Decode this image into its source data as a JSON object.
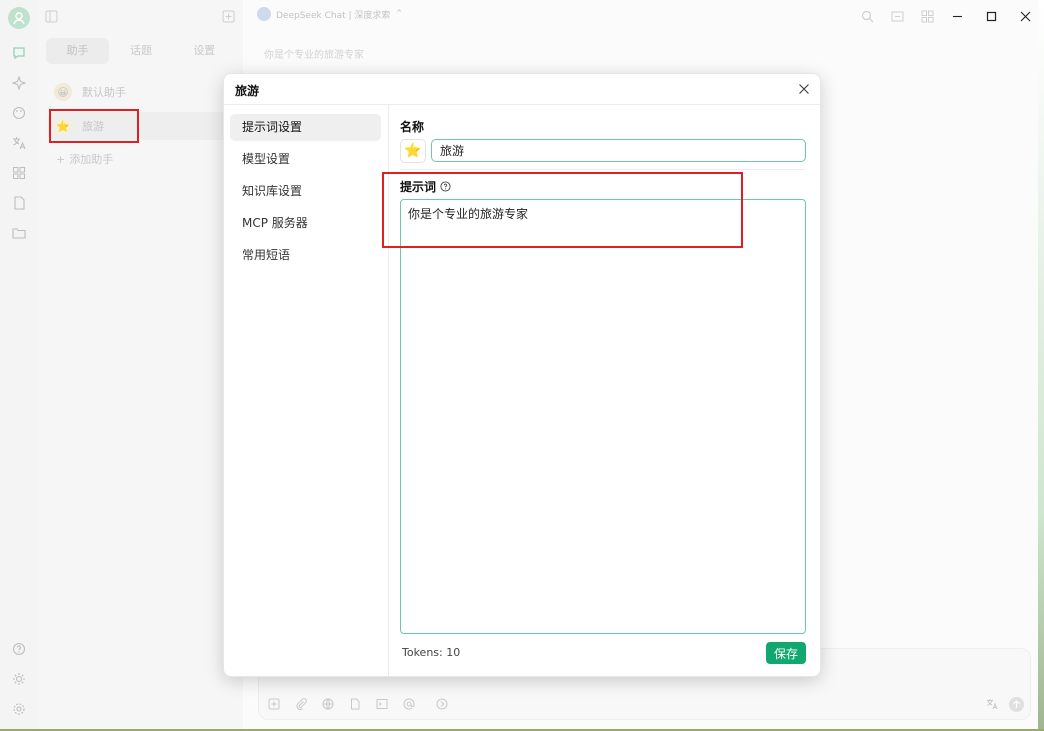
{
  "model": {
    "name": "DeepSeek Chat | 深度求索"
  },
  "panel": {
    "tabs": [
      {
        "label": "助手"
      },
      {
        "label": "话题"
      },
      {
        "label": "设置"
      }
    ],
    "assistants": [
      {
        "label": "默认助手",
        "emoji": "😀"
      },
      {
        "label": "旅游",
        "emoji": "⭐"
      }
    ],
    "add_label": "添加助手"
  },
  "chat": {
    "hint": "你是个专业的旅游专家"
  },
  "modal": {
    "title": "旅游",
    "nav": [
      {
        "label": "提示词设置"
      },
      {
        "label": "模型设置"
      },
      {
        "label": "知识库设置"
      },
      {
        "label": "MCP 服务器"
      },
      {
        "label": "常用短语"
      }
    ],
    "name_label": "名称",
    "name_emoji": "⭐",
    "name_value": "旅游",
    "prompt_label": "提示词",
    "prompt_value": "你是个专业的旅游专家",
    "tokens_text": "Tokens: 10",
    "save_label": "保存"
  },
  "colors": {
    "accent": "#11a870",
    "input_border": "#6fc7a6",
    "highlight": "#e02020"
  }
}
